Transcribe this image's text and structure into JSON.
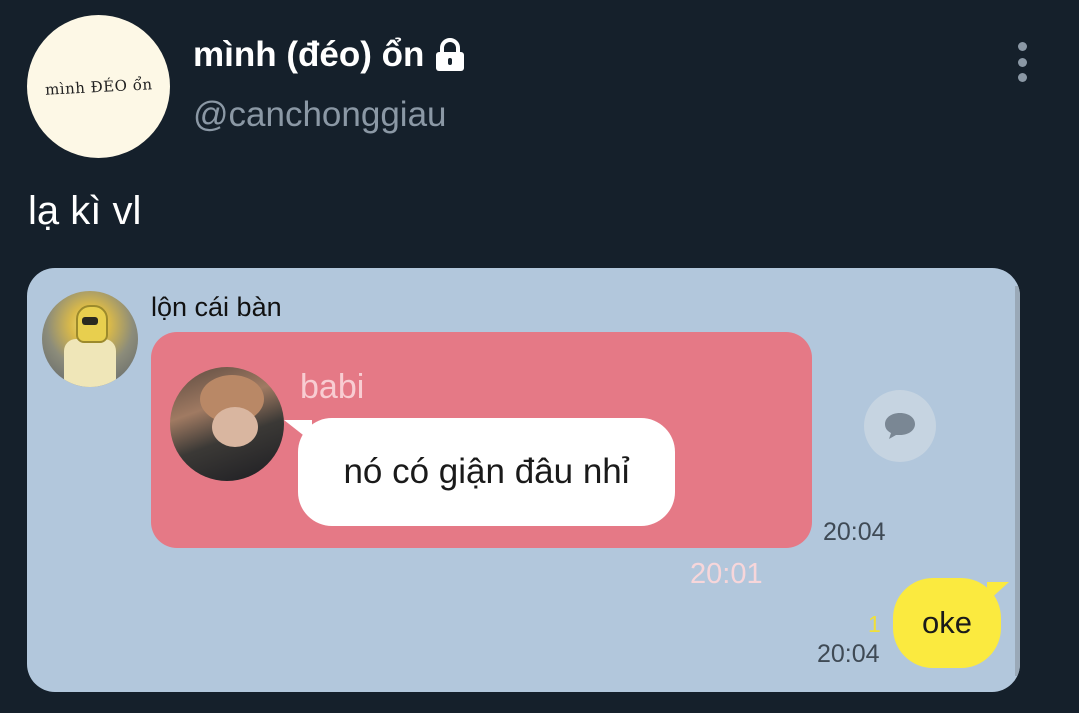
{
  "profile": {
    "avatar_text": "mình ĐÉO ổn",
    "display_name": "mình (đéo) ổn",
    "handle": "@canchonggiau",
    "lock_icon": "lock-icon",
    "more_icon": "vertical-ellipsis-icon"
  },
  "tweet": {
    "text": "lạ kì vl"
  },
  "chat": {
    "sender_name": "lộn cái bàn",
    "forwarded": {
      "name": "babi",
      "message": "nó có giận đâu nhỉ",
      "time": "20:01"
    },
    "message_time": "20:04",
    "share_icon": "speech-bubble-icon",
    "reply": {
      "read_count": "1",
      "time": "20:04",
      "text": "oke"
    }
  },
  "colors": {
    "background": "#15202b",
    "chat_background": "#b2c7dc",
    "forward_bubble": "#e57986",
    "reply_bubble": "#fbea3f"
  }
}
